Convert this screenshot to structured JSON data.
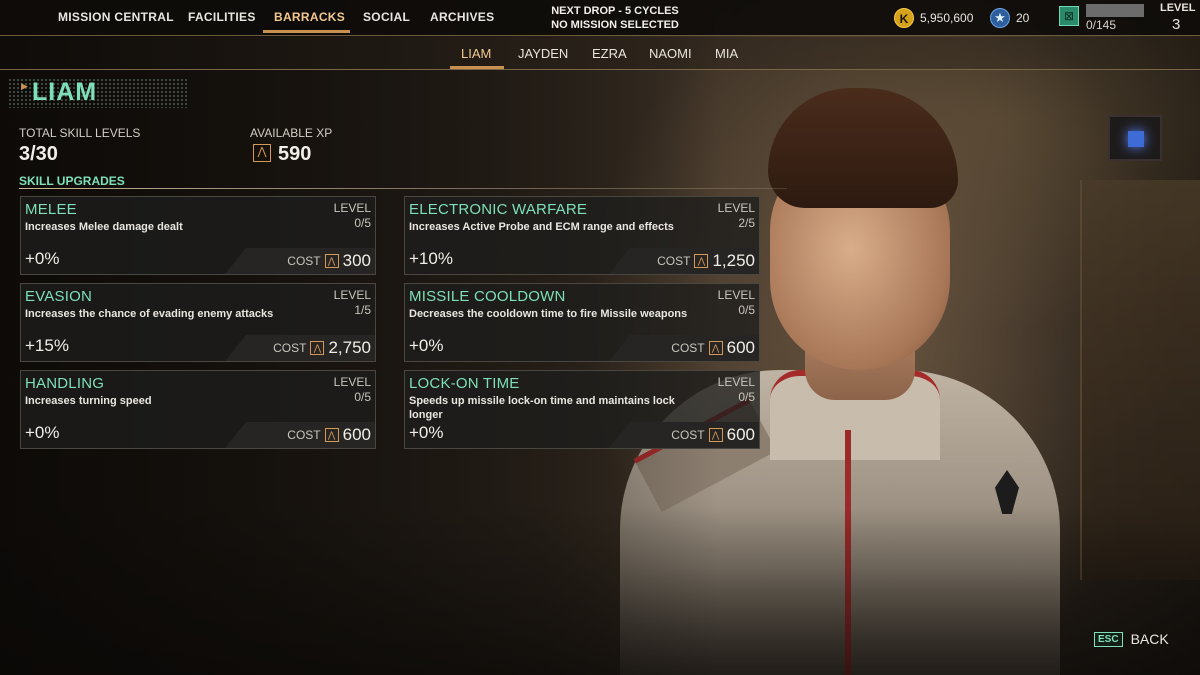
{
  "nav": {
    "items": [
      "MISSION CENTRAL",
      "FACILITIES",
      "BARRACKS",
      "SOCIAL",
      "ARCHIVES"
    ],
    "active": "BARRACKS"
  },
  "status": {
    "next_drop": "NEXT DROP - 5 CYCLES",
    "mission": "NO MISSION SELECTED"
  },
  "resources": {
    "currency_icon": "K",
    "currency": "5,950,600",
    "star_icon": "★",
    "stars": "20",
    "crate_icon": "⊠",
    "crates": "0/145",
    "level_label": "LEVEL",
    "level": "3"
  },
  "tabs": {
    "items": [
      "LIAM",
      "JAYDEN",
      "EZRA",
      "NAOMI",
      "MIA"
    ],
    "active": "LIAM"
  },
  "pilot": {
    "name": "LIAM",
    "total_label": "TOTAL SKILL LEVELS",
    "total_value": "3/30",
    "xp_label": "AVAILABLE XP",
    "xp_icon": "⋀",
    "xp_value": "590"
  },
  "skills": {
    "section_title": "SKILL UPGRADES",
    "level_label": "LEVEL",
    "cost_label": "COST",
    "cost_icon": "⋀",
    "items": [
      {
        "title": "MELEE",
        "desc": "Increases Melee damage dealt",
        "level": "0/5",
        "bonus": "+0%",
        "cost": "300"
      },
      {
        "title": "ELECTRONIC WARFARE",
        "desc": "Increases Active Probe and ECM range and effects",
        "level": "2/5",
        "bonus": "+10%",
        "cost": "1,250"
      },
      {
        "title": "EVASION",
        "desc": "Increases the chance of evading enemy attacks",
        "level": "1/5",
        "bonus": "+15%",
        "cost": "2,750"
      },
      {
        "title": "MISSILE COOLDOWN",
        "desc": "Decreases the cooldown time to fire Missile weapons",
        "level": "0/5",
        "bonus": "+0%",
        "cost": "600"
      },
      {
        "title": "HANDLING",
        "desc": "Increases turning speed",
        "level": "0/5",
        "bonus": "+0%",
        "cost": "600"
      },
      {
        "title": "LOCK-ON TIME",
        "desc": "Speeds up missile lock-on time and maintains lock longer",
        "level": "0/5",
        "bonus": "+0%",
        "cost": "600"
      }
    ]
  },
  "footer": {
    "esc_key": "ESC",
    "back_label": "BACK"
  },
  "colors": {
    "accent": "#7ee0b8",
    "highlight": "#f0c890",
    "underline": "#c8914f"
  }
}
